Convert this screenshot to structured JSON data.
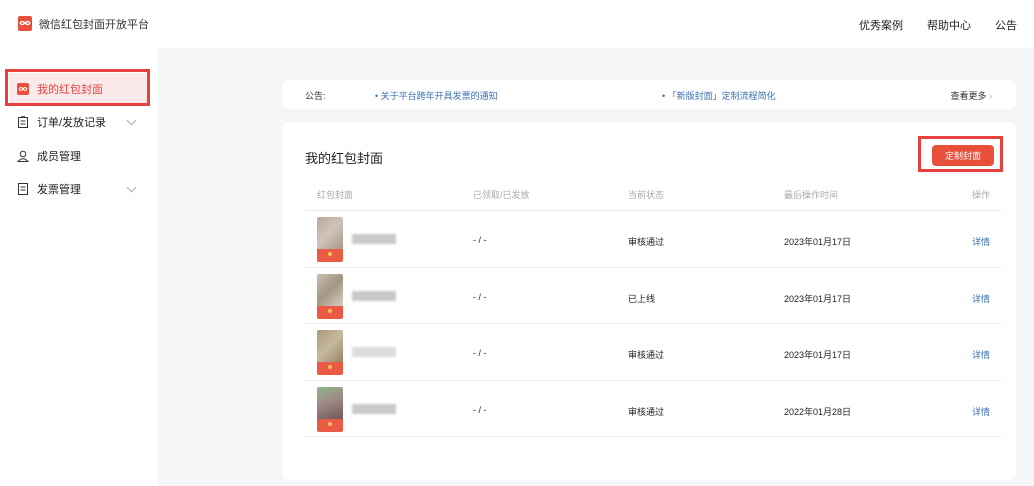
{
  "header": {
    "app_title": "微信红包封面开放平台",
    "nav": [
      "优秀案例",
      "帮助中心",
      "公告"
    ]
  },
  "sidebar": {
    "items": [
      {
        "label": "我的红包封面",
        "icon": "redpacket-icon",
        "active": true
      },
      {
        "label": "订单/发放记录",
        "icon": "clipboard-icon",
        "expandable": true
      },
      {
        "label": "成员管理",
        "icon": "user-icon"
      },
      {
        "label": "发票管理",
        "icon": "document-icon",
        "expandable": true
      }
    ]
  },
  "notice": {
    "label": "公告:",
    "items": [
      "关于平台跨年开具发票的通知",
      "「新版封面」定制流程简化"
    ],
    "more": "查看更多"
  },
  "main": {
    "title": "我的红包封面",
    "custom_button": "定制封面",
    "columns": [
      "红包封面",
      "已领取/已发放",
      "当前状态",
      "最后操作时间",
      "操作"
    ],
    "rows": [
      {
        "claimed": "- / -",
        "status": "审核通过",
        "time": "2023年01月17日",
        "action": "详情"
      },
      {
        "claimed": "- / -",
        "status": "已上线",
        "time": "2023年01月17日",
        "action": "详情"
      },
      {
        "claimed": "- / -",
        "status": "审核通过",
        "time": "2023年01月17日",
        "action": "详情"
      },
      {
        "claimed": "- / -",
        "status": "审核通过",
        "time": "2022年01月28日",
        "action": "详情"
      }
    ]
  },
  "colors": {
    "accent": "#e8503a",
    "highlight": "#e8403d",
    "active_bg": "#fbeaea",
    "link": "#3a6fb5"
  }
}
